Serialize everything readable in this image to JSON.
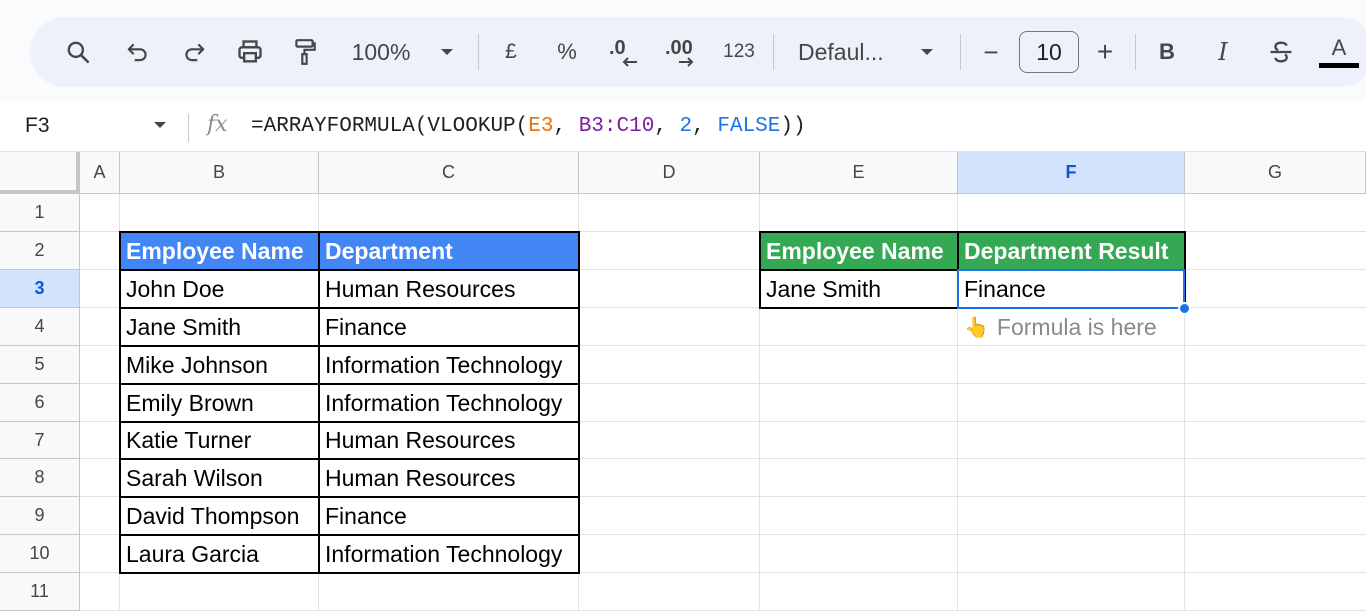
{
  "toolbar": {
    "zoom": "100%",
    "currency": "£",
    "percent": "%",
    "decrease_decimal": ".0",
    "increase_decimal": ".00",
    "number_format": "123",
    "font_name": "Defaul...",
    "font_size": "10",
    "minus": "−",
    "plus": "+",
    "bold": "B",
    "italic": "I",
    "text_color": "A"
  },
  "formula_bar": {
    "cell_ref": "F3",
    "fx": "fx",
    "formula": "=ARRAYFORMULA(VLOOKUP(E3, B3:C10, 2, FALSE))",
    "parts": {
      "prefix": "=ARRAYFORMULA(VLOOKUP(",
      "e3": "E3",
      "sep1": ", ",
      "range": "B3:C10",
      "sep2": ", ",
      "index": "2",
      "sep3": ", ",
      "bool": "FALSE",
      "suffix": "))"
    }
  },
  "columns": [
    "A",
    "B",
    "C",
    "D",
    "E",
    "F",
    "G"
  ],
  "rows": [
    "1",
    "2",
    "3",
    "4",
    "5",
    "6",
    "7",
    "8",
    "9",
    "10",
    "11"
  ],
  "selected": {
    "column": "F",
    "row": "3"
  },
  "table": {
    "headers": [
      "Employee Name",
      "Department"
    ],
    "rows": [
      [
        "John Doe",
        "Human Resources"
      ],
      [
        "Jane Smith",
        "Finance"
      ],
      [
        "Mike Johnson",
        "Information Technology"
      ],
      [
        "Emily Brown",
        "Information Technology"
      ],
      [
        "Katie Turner",
        "Human Resources"
      ],
      [
        "Sarah Wilson",
        "Human Resources"
      ],
      [
        "David Thompson",
        "Finance"
      ],
      [
        "Laura Garcia",
        "Information Technology"
      ]
    ]
  },
  "lookup": {
    "headers": [
      "Employee Name",
      "Department Result"
    ],
    "input": "Jane Smith",
    "result": "Finance",
    "note_icon": "👆",
    "note": "Formula is here"
  },
  "colors": {
    "blue_header": "#4285f4",
    "green_header": "#34a853",
    "selection": "#1a73e8"
  }
}
